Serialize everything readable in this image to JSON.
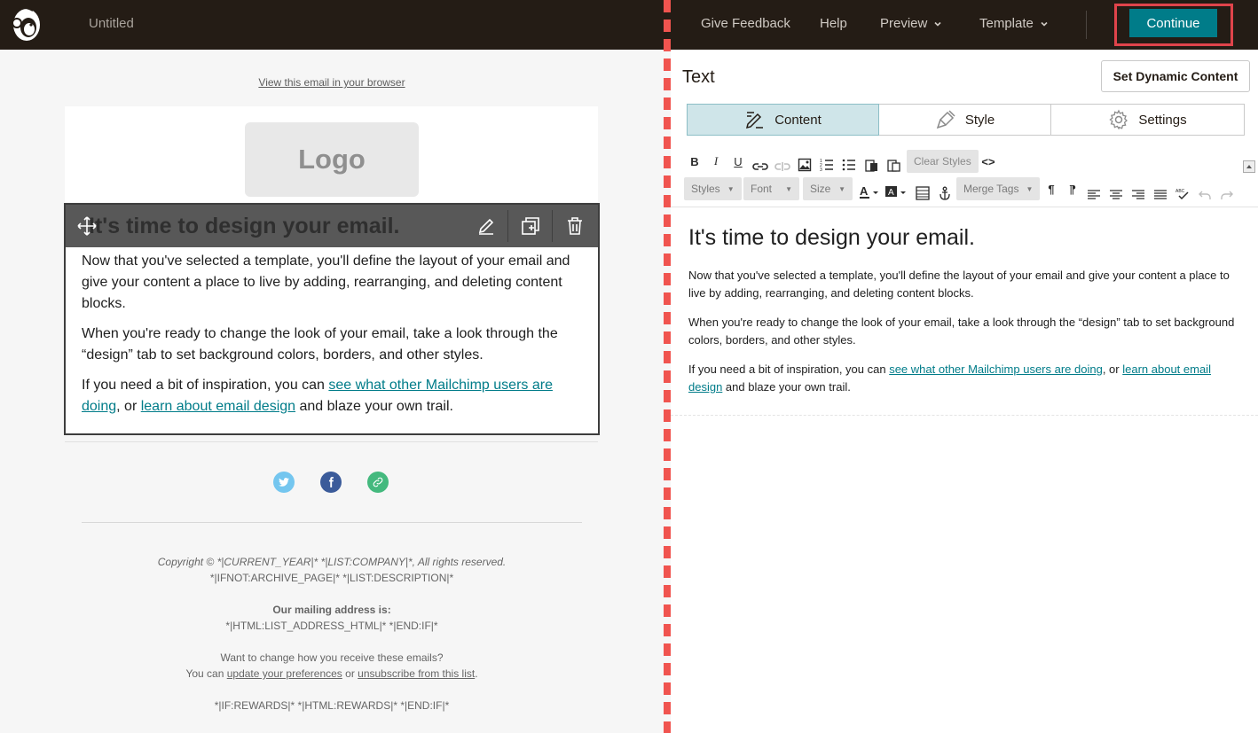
{
  "topbar": {
    "doc_title": "Untitled",
    "nav": {
      "give_feedback": "Give Feedback",
      "help": "Help",
      "preview": "Preview",
      "template": "Template"
    },
    "continue": "Continue",
    "logo_icon": "freddie-icon",
    "colors": {
      "bar": "#241c15",
      "accent": "#007c89",
      "highlight": "#e0444b"
    }
  },
  "preview": {
    "view_in_browser": "View this email in your browser",
    "logo_placeholder": "Logo",
    "block": {
      "heading": "It's time to design your email.",
      "p1": "Now that you've selected a template, you'll define the layout of your email and give your content a place to live by adding, rearranging, and deleting content blocks.",
      "p2": "When you're ready to change the look of your email, take a look through the “design” tab to set background colors, borders, and other styles.",
      "p3_before": "If you need a bit of inspiration, you can ",
      "p3_link1": "see what other Mailchimp users are doing",
      "p3_mid": ", or ",
      "p3_link2": "learn about email design",
      "p3_after": " and blaze your own trail.",
      "icons": [
        "move-icon",
        "edit-icon",
        "duplicate-icon",
        "trash-icon"
      ]
    },
    "social_icons": [
      "twitter-icon",
      "facebook-icon",
      "link-icon"
    ],
    "footer": {
      "copyright": "Copyright © *|CURRENT_YEAR|* *|LIST:COMPANY|*, All rights reserved.",
      "description": "*|IFNOT:ARCHIVE_PAGE|* *|LIST:DESCRIPTION|*",
      "address_label": "Our mailing address is:",
      "address": "*|HTML:LIST_ADDRESS_HTML|* *|END:IF|*",
      "change": "Want to change how you receive these emails?",
      "can_prefix": "You can ",
      "update_prefs": "update your preferences",
      "or": " or ",
      "unsubscribe": "unsubscribe from this list",
      "period": ".",
      "rewards": "*|IF:REWARDS|* *|HTML:REWARDS|* *|END:IF|*"
    }
  },
  "panel": {
    "title": "Text",
    "dynamic": "Set Dynamic Content",
    "tabs": [
      {
        "label": "Content",
        "icon": "pencil-lines-icon"
      },
      {
        "label": "Style",
        "icon": "paint-brush-icon"
      },
      {
        "label": "Settings",
        "icon": "gear-icon"
      }
    ],
    "toolbar": {
      "bold": "B",
      "italic": "I",
      "underline": "U",
      "clear_styles": "Clear Styles",
      "source": "<>",
      "styles": "Styles",
      "font": "Font",
      "size": "Size",
      "merge_tags": "Merge Tags"
    },
    "editor": {
      "heading": "It's time to design your email.",
      "p1": "Now that you've selected a template, you'll define the layout of your email and give your content a place to live by adding, rearranging, and deleting content blocks.",
      "p2": "When you're ready to change the look of your email, take a look through the “design” tab to set background colors, borders, and other styles.",
      "p3_before": "If you need a bit of inspiration, you can ",
      "p3_link1": "see what other Mailchimp users are doing",
      "p3_mid": ", or ",
      "p3_link2": "learn about email design",
      "p3_after": " and blaze your own trail."
    }
  }
}
